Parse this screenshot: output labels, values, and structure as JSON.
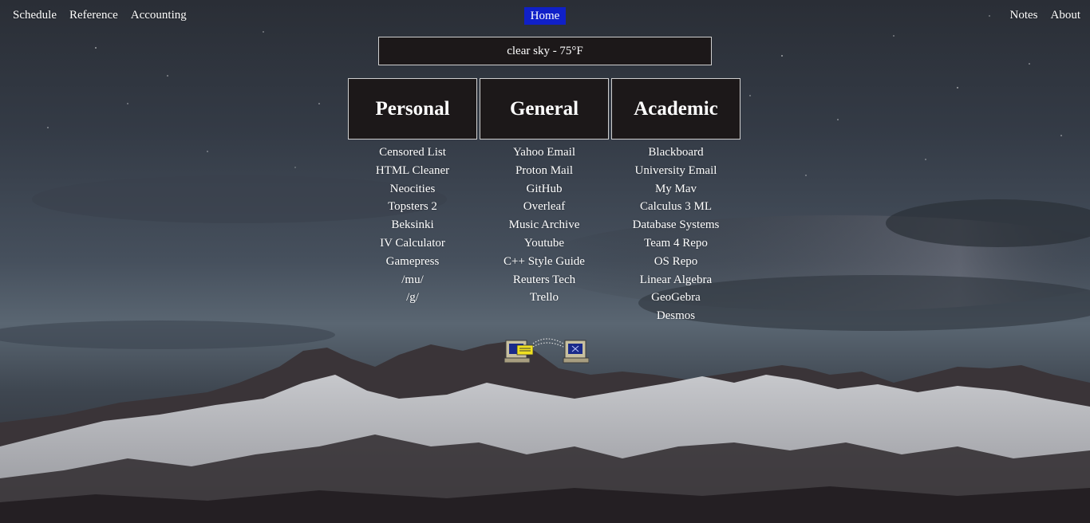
{
  "nav": {
    "left": [
      "Schedule",
      "Reference",
      "Accounting"
    ],
    "home": "Home",
    "right": [
      "Notes",
      "About"
    ]
  },
  "weather": {
    "text": "clear sky - 75°F"
  },
  "columns": [
    {
      "title": "Personal",
      "links": [
        "Censored List",
        "HTML Cleaner",
        "Neocities",
        "Topsters 2",
        "Beksinki",
        "IV Calculator",
        "Gamepress",
        "/mu/",
        "/g/"
      ]
    },
    {
      "title": "General",
      "links": [
        "Yahoo Email",
        "Proton Mail",
        "GitHub",
        "Overleaf",
        "Music Archive",
        "Youtube",
        "C++ Style Guide",
        "Reuters Tech",
        "Trello"
      ]
    },
    {
      "title": "Academic",
      "links": [
        "Blackboard",
        "University Email",
        "My Mav",
        "Calculus 3 ML",
        "Database Systems",
        "Team 4 Repo",
        "OS Repo",
        "Linear Algebra",
        "GeoGebra",
        "Desmos"
      ]
    }
  ],
  "colors": {
    "home_bg": "#1020c8",
    "panel_bg": "#1c1819",
    "panel_border": "#cfcfcf",
    "text": "#ffffff"
  },
  "icons": {
    "background": "mountain-night-sky-image",
    "connection": "network-computers-icon"
  }
}
